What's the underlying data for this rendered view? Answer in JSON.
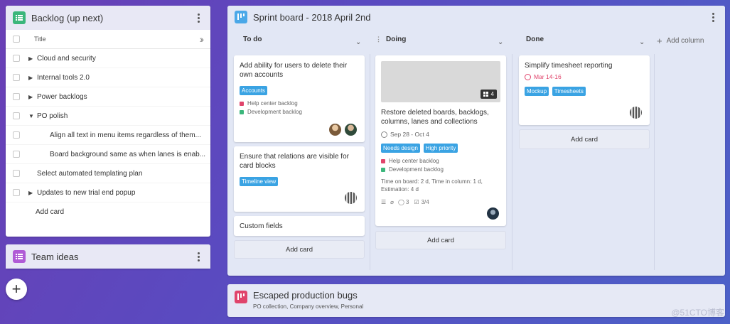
{
  "backlog": {
    "title": "Backlog (up next)",
    "column_header": "Title",
    "rows": [
      {
        "label": "Cloud and security",
        "expand": "right"
      },
      {
        "label": "Internal tools 2.0",
        "expand": "right"
      },
      {
        "label": "Power backlogs",
        "expand": "right"
      },
      {
        "label": "PO polish",
        "expand": "down"
      },
      {
        "label": "Align all text in menu items regardless of them...",
        "expand": "none"
      },
      {
        "label": "Board background same as when lanes is enab...",
        "expand": "none"
      },
      {
        "label": "Select automated templating plan",
        "expand": "none"
      },
      {
        "label": "Updates to new trial end popup",
        "expand": "right"
      }
    ],
    "add_card": "Add card"
  },
  "ideas": {
    "title": "Team ideas"
  },
  "sprint": {
    "title": "Sprint board - 2018 April 2nd",
    "columns": {
      "todo": "To do",
      "doing": "Doing",
      "done": "Done"
    },
    "add_column": "Add column",
    "todo_cards": [
      {
        "title": "Add ability for users to delete their own accounts",
        "tags": [
          "Accounts"
        ],
        "collections": [
          "Help center backlog",
          "Development backlog"
        ]
      },
      {
        "title": "Ensure that relations are visible for card blocks",
        "tags": [
          "Timeline view"
        ]
      },
      {
        "title": "Custom fields"
      }
    ],
    "doing_card": {
      "image_count": "4",
      "title": "Restore deleted boards, backlogs, columns, lanes and collections",
      "dates": "Sep 28 - Oct 4",
      "tags": [
        "Needs design",
        "High priority"
      ],
      "collections": [
        "Help center backlog",
        "Development backlog"
      ],
      "time_info": "Time on board: 2 d, Time in column: 1 d, Estimation: 4 d",
      "comments": "3",
      "checklist": "3/4"
    },
    "done_card": {
      "title": "Simplify timesheet reporting",
      "due": "Mar 14-16",
      "tags": [
        "Mockup",
        "Timesheets"
      ]
    },
    "add_card": "Add card"
  },
  "escaped": {
    "title": "Escaped production bugs",
    "subtitle": "PO collection, Company overview, Personal"
  },
  "watermark": "@51CTO博客",
  "colors": {
    "tag": "#3aa3e3",
    "help_center": "#e0446b",
    "development": "#3bb67b",
    "backlog_icon": "#3bb67b",
    "ideas_icon": "#b05bd6",
    "sprint_icon": "#4aa8e8",
    "escaped_icon": "#e0446b"
  }
}
